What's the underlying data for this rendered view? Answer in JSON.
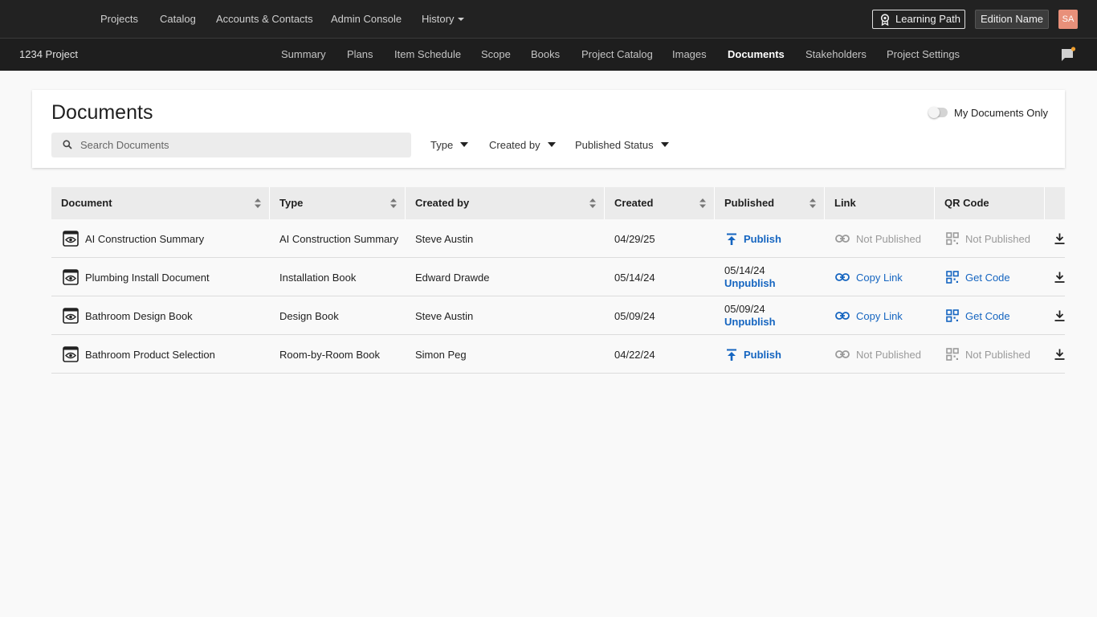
{
  "topnav": {
    "items": [
      "Projects",
      "Catalog",
      "Accounts & Contacts",
      "Admin Console",
      "History"
    ],
    "learning_path": "Learning Path",
    "edition": "Edition Name",
    "avatar": "SA"
  },
  "subnav": {
    "project": "1234 Project",
    "tabs": [
      "Summary",
      "Plans",
      "Item Schedule",
      "Scope",
      "Books",
      "Project Catalog",
      "Images",
      "Documents",
      "Stakeholders",
      "Project Settings"
    ],
    "active_tab": "Documents"
  },
  "header": {
    "title": "Documents",
    "search_placeholder": "Search Documents",
    "filters": [
      "Type",
      "Created by",
      "Published Status"
    ],
    "toggle_label": "My Documents Only",
    "toggle_on": false
  },
  "table": {
    "columns": [
      "Document",
      "Type",
      "Created by",
      "Created",
      "Published",
      "Link",
      "QR Code"
    ],
    "rows": [
      {
        "document": "AI Construction Summary",
        "type": "AI Construction Summary",
        "created_by": "Steve Austin",
        "created": "04/29/25",
        "published_date": "",
        "published_action": "Publish",
        "link": "Not Published",
        "qr": "Not Published",
        "is_published": false
      },
      {
        "document": "Plumbing Install Document",
        "type": "Installation Book",
        "created_by": "Edward Drawde",
        "created": "05/14/24",
        "published_date": "05/14/24",
        "published_action": "Unpublish",
        "link": "Copy Link",
        "qr": "Get Code",
        "is_published": true
      },
      {
        "document": "Bathroom Design Book",
        "type": "Design Book",
        "created_by": "Steve Austin",
        "created": "05/09/24",
        "published_date": "05/09/24",
        "published_action": "Unpublish",
        "link": "Copy Link",
        "qr": "Get Code",
        "is_published": true
      },
      {
        "document": "Bathroom Product Selection",
        "type": "Room-by-Room Book",
        "created_by": "Simon Peg",
        "created": "04/22/24",
        "published_date": "",
        "published_action": "Publish",
        "link": "Not Published",
        "qr": "Not Published",
        "is_published": false
      }
    ]
  },
  "colors": {
    "accent": "#1565c0",
    "muted": "#9a9a9a",
    "avatar": "#e8907a",
    "notification_dot": "#f0a030"
  },
  "icons": {
    "document_row": "eye-document-icon",
    "publish": "upload-arrow-icon",
    "link": "chain-link-icon",
    "qr": "qr-code-icon",
    "download": "download-icon",
    "chat": "chat-flag-icon",
    "learning": "badge-icon"
  }
}
